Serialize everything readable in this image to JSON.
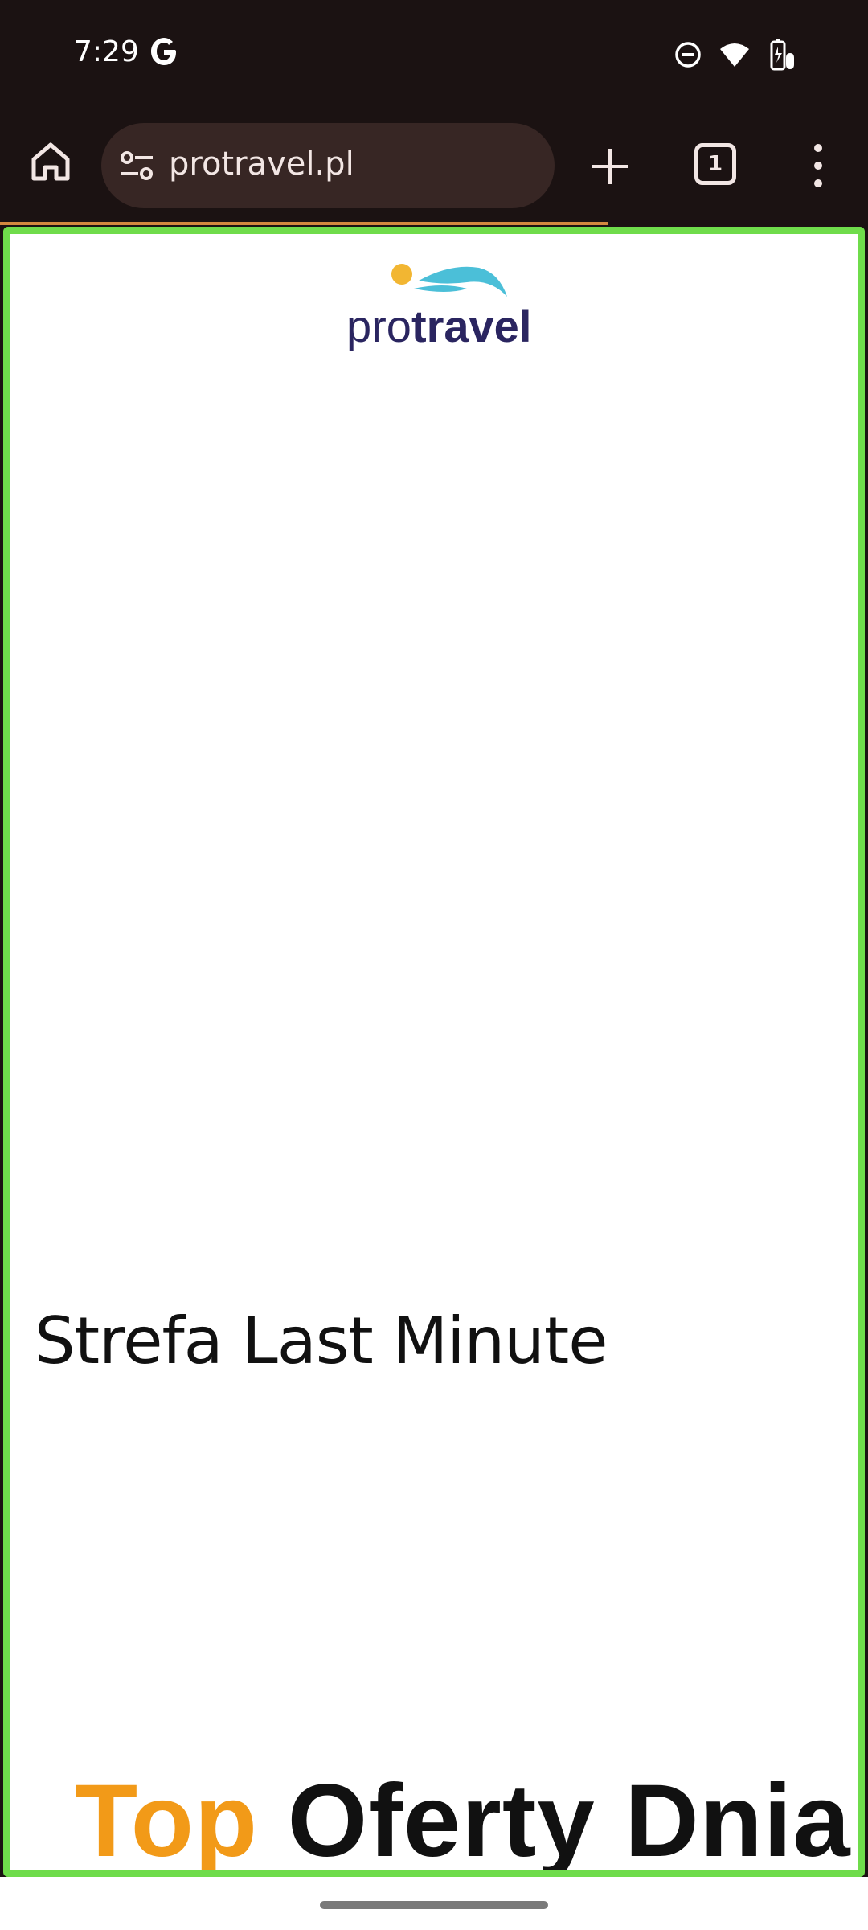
{
  "status_bar": {
    "time": "7:29",
    "icons": [
      "google-g-icon",
      "do-not-disturb-icon",
      "wifi-icon",
      "battery-icon"
    ]
  },
  "browser": {
    "url": "protravel.pl",
    "tab_count": "1",
    "icons": [
      "home-icon",
      "site-settings-icon",
      "plus-icon",
      "tabs-icon",
      "more-vert-icon"
    ],
    "progress_fraction": 0.7
  },
  "page": {
    "logo": {
      "part_light": "pro",
      "part_bold": "travel"
    },
    "section_title": "Strefa Last Minute",
    "hero": {
      "accent": "Top",
      "rest": "Oferty Dnia!"
    }
  },
  "colors": {
    "system_bg": "#1b1212",
    "urlbar_bg": "#372624",
    "content_border": "#6fdc4b",
    "accent_orange": "#f29a18",
    "logo_navy": "#2a2560",
    "logo_cyan": "#4bbfd8",
    "logo_sun": "#f2b632"
  }
}
